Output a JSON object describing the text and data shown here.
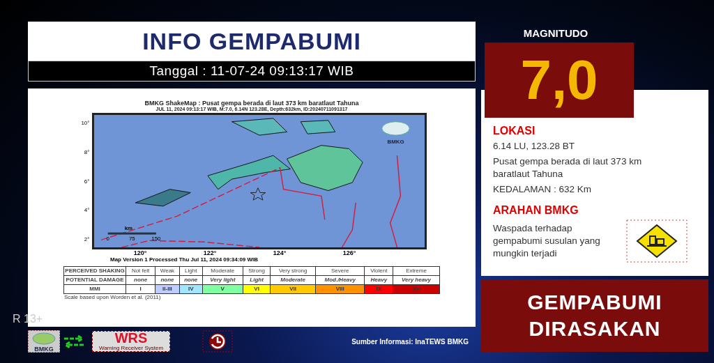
{
  "header": {
    "title": "INFO GEMPABUMI",
    "date": "Tanggal : 11-07-24 09:13:17 WIB"
  },
  "shakemap": {
    "title": "BMKG ShakeMap : Pusat gempa berada di laut 373 km baratlaut Tahuna",
    "subtitle": "JUL 11, 2024 09:13:17 WIB, M:7.0, 6.14N 123.28E, Depth:632km, ID:20240711091317",
    "y_labels": [
      "10°",
      "8°",
      "6°",
      "4°",
      "2°"
    ],
    "x_labels": [
      "120°",
      "122°",
      "124°",
      "126°"
    ],
    "scale": {
      "unit": "km",
      "ticks": [
        "0",
        "75",
        "150"
      ]
    },
    "logo_text": "BMKG",
    "version": "Map Version 1 Processed Thu Jul 11, 2024 09:34:09 WIB",
    "legend": {
      "row_labels": [
        "PERCEIVED SHAKING",
        "POTENTIAL DAMAGE",
        "MMI"
      ],
      "columns": [
        {
          "shaking": "Not felt",
          "damage": "none",
          "mmi": "I",
          "color": "#ffffff"
        },
        {
          "shaking": "Weak",
          "damage": "none",
          "mmi": "II-III",
          "color": "#bfccff"
        },
        {
          "shaking": "Light",
          "damage": "none",
          "mmi": "IV",
          "color": "#a0e6ff"
        },
        {
          "shaking": "Moderate",
          "damage": "Very light",
          "mmi": "V",
          "color": "#80ffa0"
        },
        {
          "shaking": "Strong",
          "damage": "Light",
          "mmi": "VI",
          "color": "#ffff00"
        },
        {
          "shaking": "Very strong",
          "damage": "Moderate",
          "mmi": "VII",
          "color": "#ffc800"
        },
        {
          "shaking": "Severe",
          "damage": "Mod./Heavy",
          "mmi": "VIII",
          "color": "#ff9100"
        },
        {
          "shaking": "Violent",
          "damage": "Heavy",
          "mmi": "IX",
          "color": "#ff0000"
        },
        {
          "shaking": "Extreme",
          "damage": "Very heavy",
          "mmi": "X+",
          "color": "#c80000"
        }
      ],
      "note": "Scale based upon Worden et al. (2011)"
    }
  },
  "rating": "R 13+",
  "footer": {
    "wrs_title": "WRS",
    "wrs_subtitle": "Warning Receiver System",
    "bmkg_logo_text": "BMKG",
    "source": "Sumber Informasi: InaTEWS BMKG"
  },
  "magnitude": {
    "label": "MAGNITUDO",
    "value": "7,0"
  },
  "info": {
    "location_heading": "LOKASI",
    "coordinates": "6.14 LU, 123.28 BT",
    "description": "Pusat gempa berada di laut 373 km baratlaut Tahuna",
    "depth": "KEDALAMAN : 632 Km",
    "advice_heading": "ARAHAN BMKG",
    "advice": "Waspada terhadap gempabumi susulan yang mungkin terjadi"
  },
  "banner": "GEMPABUMI DIRASAKAN"
}
